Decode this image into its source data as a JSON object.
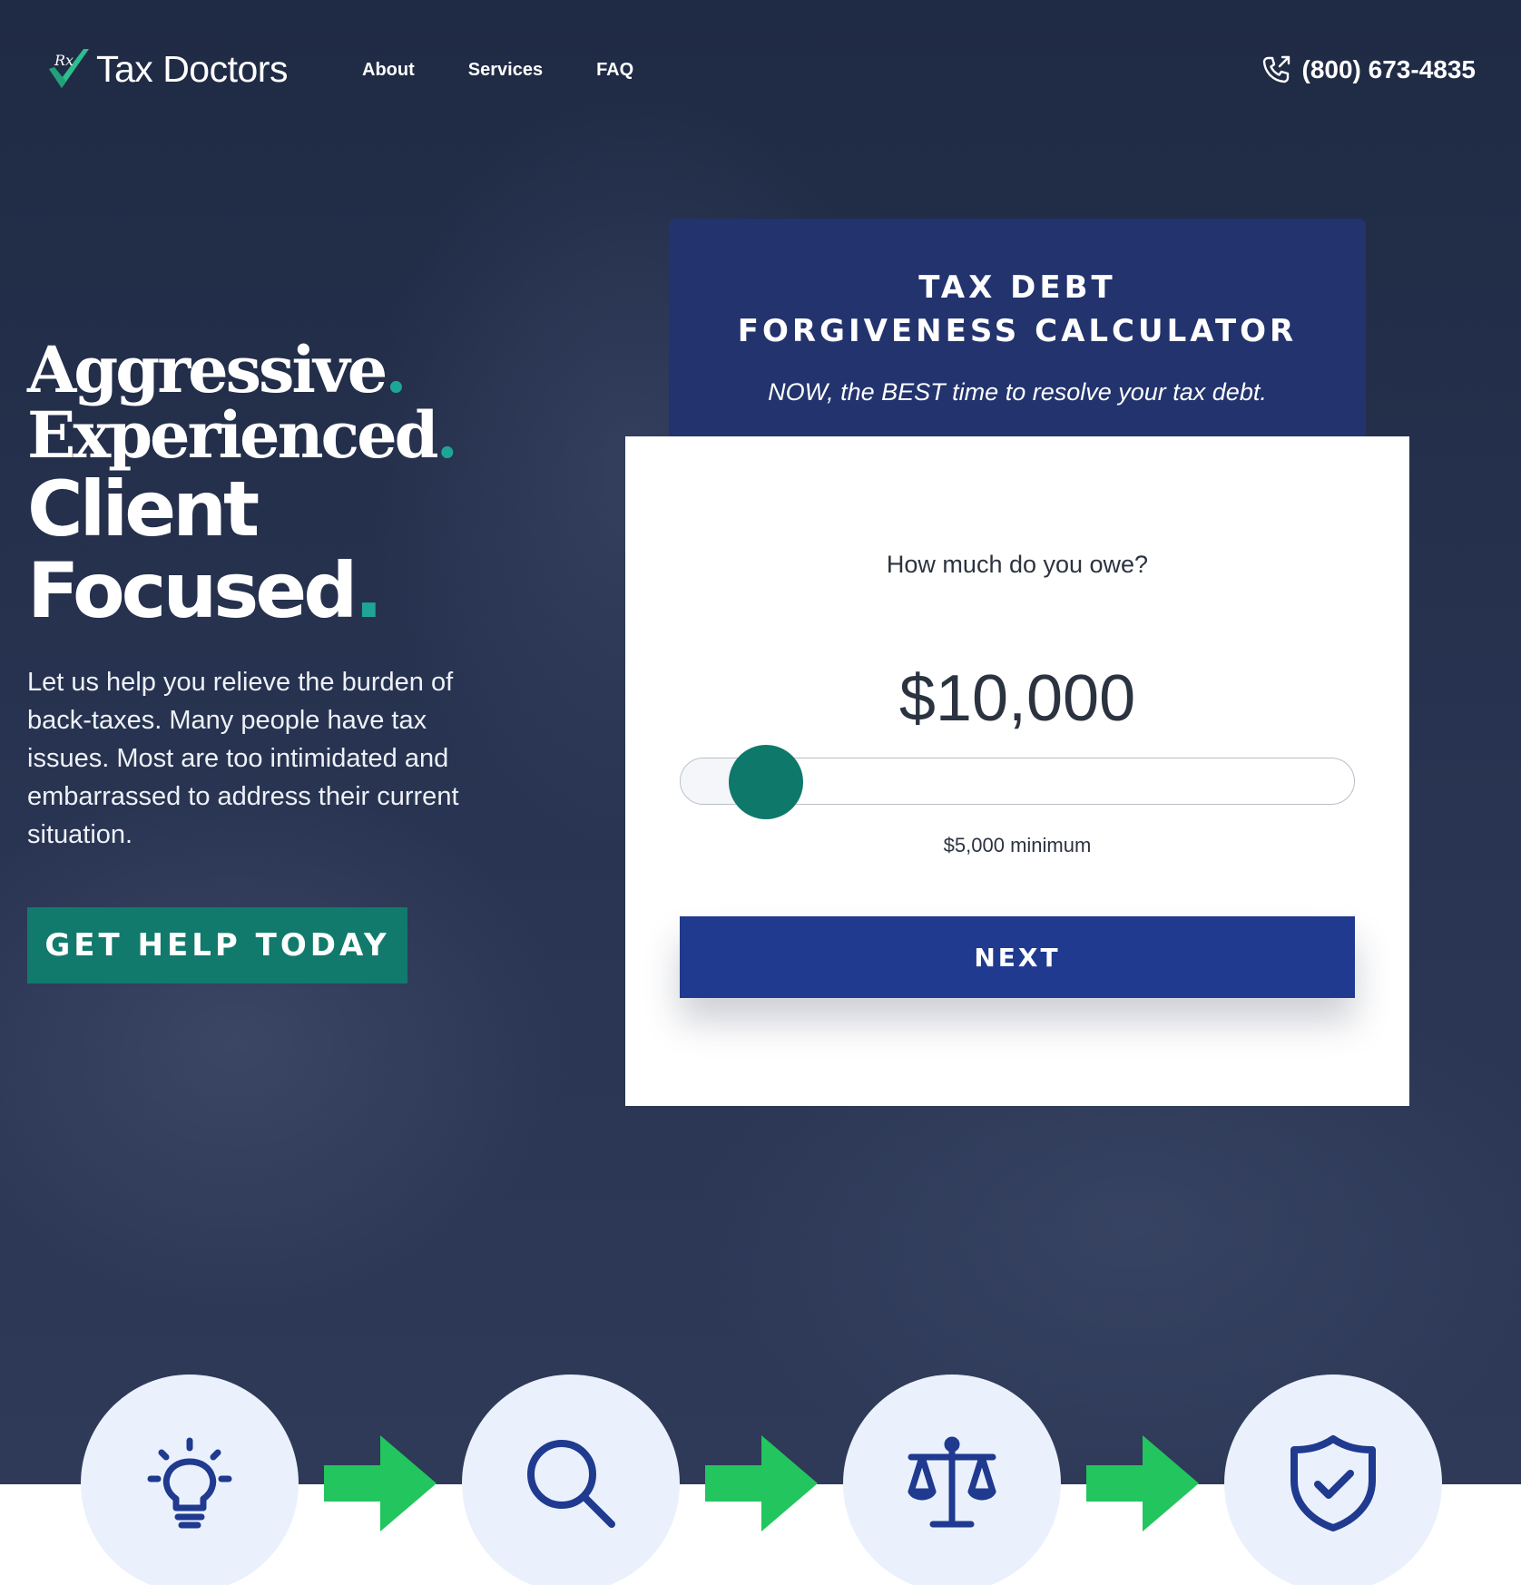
{
  "brand": {
    "name": "Tax Doctors",
    "logo_icon": "rx-checkmark-icon",
    "accent_color": "#1fa596"
  },
  "nav": {
    "items": [
      "About",
      "Services",
      "FAQ"
    ]
  },
  "contact": {
    "phone": "(800) 673-4835",
    "icon": "phone-icon"
  },
  "hero": {
    "headline": [
      "Aggressive",
      "Experienced",
      "Client",
      "Focused"
    ],
    "punctuation": ".",
    "text": "Let us help you relieve the burden of back-taxes. Many people have tax issues. Most are too intimidated and embarrassed to address their current situation.",
    "cta_label": "GET HELP TODAY",
    "cta_color": "#117a6c"
  },
  "calculator": {
    "title_line1": "TAX DEBT",
    "title_line2": "FORGIVENESS CALCULATOR",
    "subtitle": "NOW, the BEST time to resolve your tax debt.",
    "question": "How much do you owe?",
    "amount": "$10,000",
    "slider_value_fraction": 0.08,
    "minimum_label": "$5,000 minimum",
    "next_label": "NEXT",
    "header_color": "#22336d",
    "button_color": "#1f3a8f",
    "thumb_color": "#0e786b"
  },
  "process": {
    "steps": [
      "lightbulb-icon",
      "search-icon",
      "scales-icon",
      "shield-check-icon"
    ],
    "arrow_color": "#22c55e",
    "icon_color": "#1f3a8f"
  }
}
